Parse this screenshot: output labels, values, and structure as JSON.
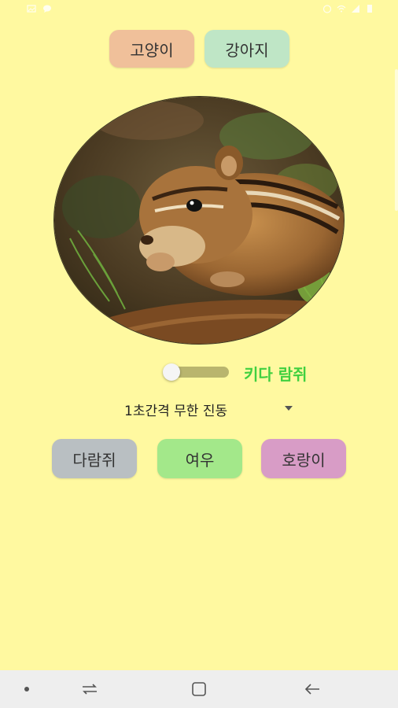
{
  "status_bar": {
    "left_text": "",
    "right_text": ""
  },
  "top_buttons": {
    "cat": "고양이",
    "dog": "강아지"
  },
  "switch": {
    "on": false,
    "label": "키다 람쥐"
  },
  "vibration_spinner": {
    "selected": "1초간격 무한 진동"
  },
  "bottom_buttons": {
    "squirrel": "다람쥐",
    "fox": "여우",
    "tiger": "호랑이"
  },
  "colors": {
    "background": "#fff9a0",
    "cat_button": "#f0c09a",
    "dog_button": "#bfe6c6",
    "squirrel_button": "#b9bfc2",
    "fox_button": "#a3e88a",
    "tiger_button": "#d89cc6",
    "switch_label": "#40d040"
  }
}
